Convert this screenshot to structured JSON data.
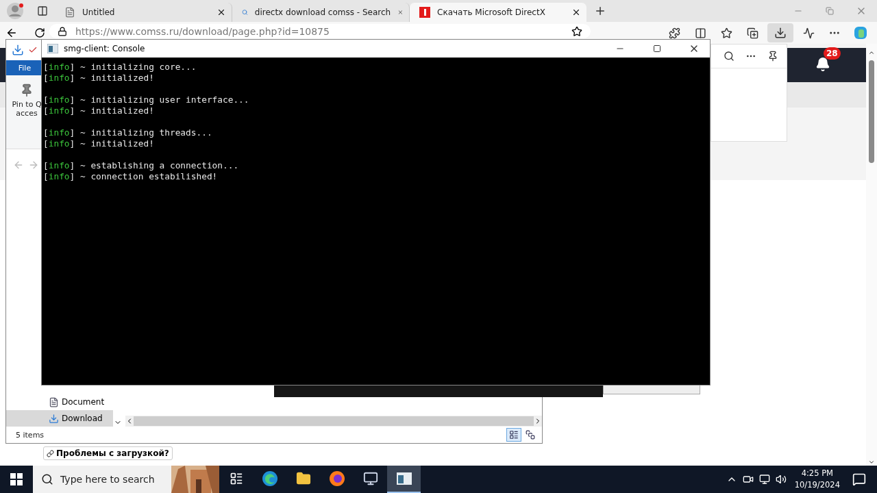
{
  "browser": {
    "tabs": [
      {
        "kind": "page",
        "title": "Untitled",
        "selected": false
      },
      {
        "kind": "search",
        "title": "directx download comss - Search",
        "selected": false
      },
      {
        "kind": "site",
        "title": "Скачать Microsoft DirectX",
        "selected": true
      }
    ],
    "url": "https://www.comss.ru/download/page.php?id=10875",
    "notification_count": "28",
    "help_button": "Проблемы с загрузкой?"
  },
  "explorer": {
    "ribbon_tab": "File",
    "pin_label": [
      "Pin to Q",
      "acces"
    ],
    "nav_items": [
      {
        "kind": "document",
        "label": "Document",
        "selected": false
      },
      {
        "kind": "download",
        "label": "Download",
        "selected": true
      }
    ],
    "status": "5 items",
    "views": [
      {
        "kind": "details",
        "selected": true
      },
      {
        "kind": "tiles",
        "selected": false
      }
    ]
  },
  "console": {
    "title": "smg-client: Console",
    "groups": [
      [
        {
          "open": "[",
          "tag": "info",
          "close": "]",
          "message": "~ initializing core..."
        },
        {
          "open": "[",
          "tag": "info",
          "close": "]",
          "message": "~ initialized!"
        }
      ],
      [
        {
          "open": "[",
          "tag": "info",
          "close": "]",
          "message": "~ initializing user interface..."
        },
        {
          "open": "[",
          "tag": "info",
          "close": "]",
          "message": "~ initialized!"
        }
      ],
      [
        {
          "open": "[",
          "tag": "info",
          "close": "]",
          "message": "~ initializing threads..."
        },
        {
          "open": "[",
          "tag": "info",
          "close": "]",
          "message": "~ initialized!"
        }
      ],
      [
        {
          "open": "[",
          "tag": "info",
          "close": "]",
          "message": "~ establishing a connection..."
        },
        {
          "open": "[",
          "tag": "info",
          "close": "]",
          "message": "~ connection estabilished!"
        }
      ]
    ]
  },
  "taskbar": {
    "search_placeholder": "Type here to search",
    "apps": [
      {
        "kind": "taskview",
        "selected": false
      },
      {
        "kind": "edge",
        "selected": false
      },
      {
        "kind": "folder",
        "selected": false
      },
      {
        "kind": "firefox",
        "selected": false
      },
      {
        "kind": "network",
        "selected": false
      },
      {
        "kind": "console",
        "selected": true
      }
    ],
    "time": "4:25 PM",
    "date": "10/19/2024"
  }
}
